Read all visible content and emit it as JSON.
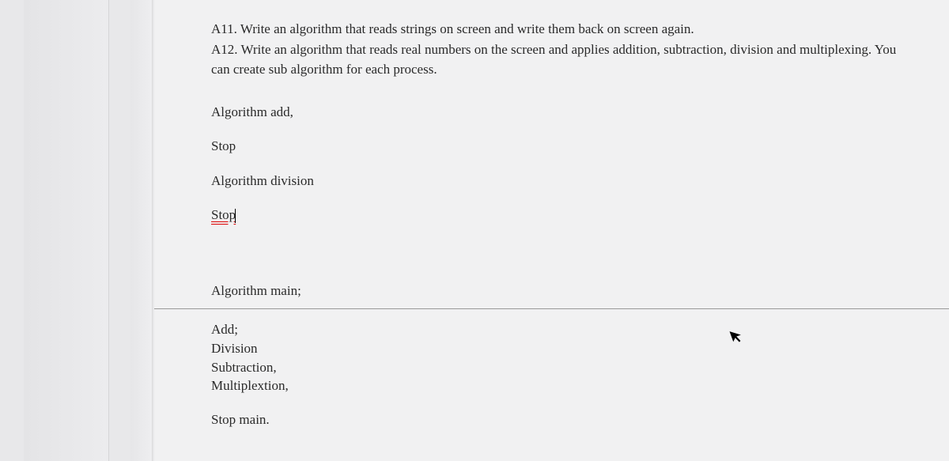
{
  "questions": {
    "a11": "A11. Write an algorithm that reads strings on screen and write them back on screen again.",
    "a12": "A12. Write an algorithm that reads real numbers on the screen and applies addition, subtraction, division and multiplexing. You can create sub algorithm for each process."
  },
  "lines": {
    "algo_add": "Algorithm add,",
    "stop1": "Stop",
    "algo_div": "Algorithm division",
    "stop2": "Stop",
    "algo_main": "Algorithm main;",
    "add_item": "Add;",
    "division_item": "Division",
    "subtraction_item": "Subtraction,",
    "multiplex_item": "Multiplextion,",
    "stop_main": "Stop main."
  }
}
